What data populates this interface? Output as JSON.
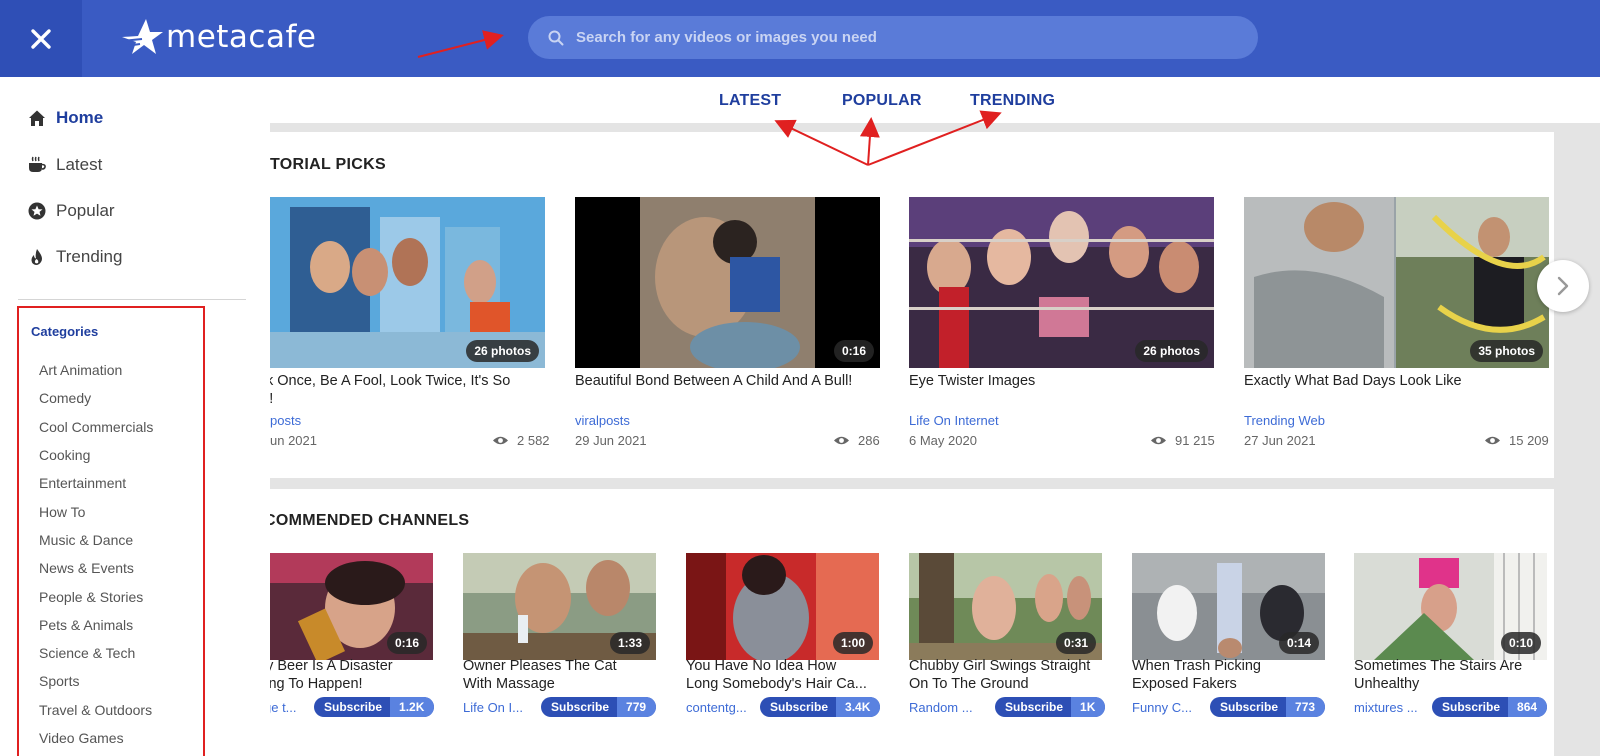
{
  "header": {
    "logo_text": "metacafe",
    "search_placeholder": "Search for any videos or images you need"
  },
  "tabs": [
    {
      "label": "LATEST"
    },
    {
      "label": "POPULAR"
    },
    {
      "label": "TRENDING"
    }
  ],
  "sidebar": {
    "nav": [
      {
        "label": "Home",
        "icon": "home-icon"
      },
      {
        "label": "Latest",
        "icon": "coffee-cup-icon"
      },
      {
        "label": "Popular",
        "icon": "star-circle-icon"
      },
      {
        "label": "Trending",
        "icon": "flame-icon"
      }
    ],
    "categories_title": "Categories",
    "categories": [
      "Art Animation",
      "Comedy",
      "Cool Commercials",
      "Cooking",
      "Entertainment",
      "How To",
      "Music & Dance",
      "News & Events",
      "People & Stories",
      "Pets & Animals",
      "Science & Tech",
      "Sports",
      "Travel & Outdoors",
      "Video Games"
    ]
  },
  "editorial": {
    "title": "TORIAL PICKS",
    "cards": [
      {
        "badge": "26 photos",
        "title_line1": "k Once, Be A Fool, Look Twice, It's So",
        "title_line2": "l!",
        "channel": "posts",
        "date": "un 2021",
        "views": "2 582"
      },
      {
        "badge": "0:16",
        "title_line1": "Beautiful Bond Between A Child And A Bull!",
        "title_line2": "",
        "channel": "viralposts",
        "date": "29 Jun 2021",
        "views": "286"
      },
      {
        "badge": "26 photos",
        "title_line1": "Eye Twister Images",
        "title_line2": "",
        "channel": "Life On Internet",
        "date": "6 May 2020",
        "views": "91 215"
      },
      {
        "badge": "35 photos",
        "title_line1": "Exactly What Bad Days Look Like",
        "title_line2": "",
        "channel": "Trending Web",
        "date": "27 Jun 2021",
        "views": "15 209"
      }
    ]
  },
  "channels": {
    "title": "COMMENDED CHANNELS",
    "subscribe_label": "Subscribe",
    "cards": [
      {
        "duration": "0:16",
        "title_line1": "hy Beer Is A Disaster",
        "title_line2": "iting To Happen!",
        "channel": "ge t...",
        "count": "1.2K"
      },
      {
        "duration": "1:33",
        "title_line1": "Owner Pleases The Cat",
        "title_line2": "With Massage",
        "channel": "Life On I...",
        "count": "779"
      },
      {
        "duration": "1:00",
        "title_line1": "You Have No Idea How",
        "title_line2": "Long Somebody's Hair Ca...",
        "channel": "contentg...",
        "count": "3.4K"
      },
      {
        "duration": "0:31",
        "title_line1": "Chubby Girl Swings Straight",
        "title_line2": "On To The Ground",
        "channel": "Random ...",
        "count": "1K"
      },
      {
        "duration": "0:14",
        "title_line1": "When Trash Picking",
        "title_line2": "Exposed Fakers",
        "channel": "Funny C...",
        "count": "773"
      },
      {
        "duration": "0:10",
        "title_line1": "Sometimes The Stairs Are",
        "title_line2": "Unhealthy",
        "channel": "mixtures ...",
        "count": "864"
      }
    ]
  },
  "colors": {
    "brand_blue": "#3a5bc3",
    "annotation_red": "#e02020",
    "link_blue": "#3d6bd6"
  }
}
